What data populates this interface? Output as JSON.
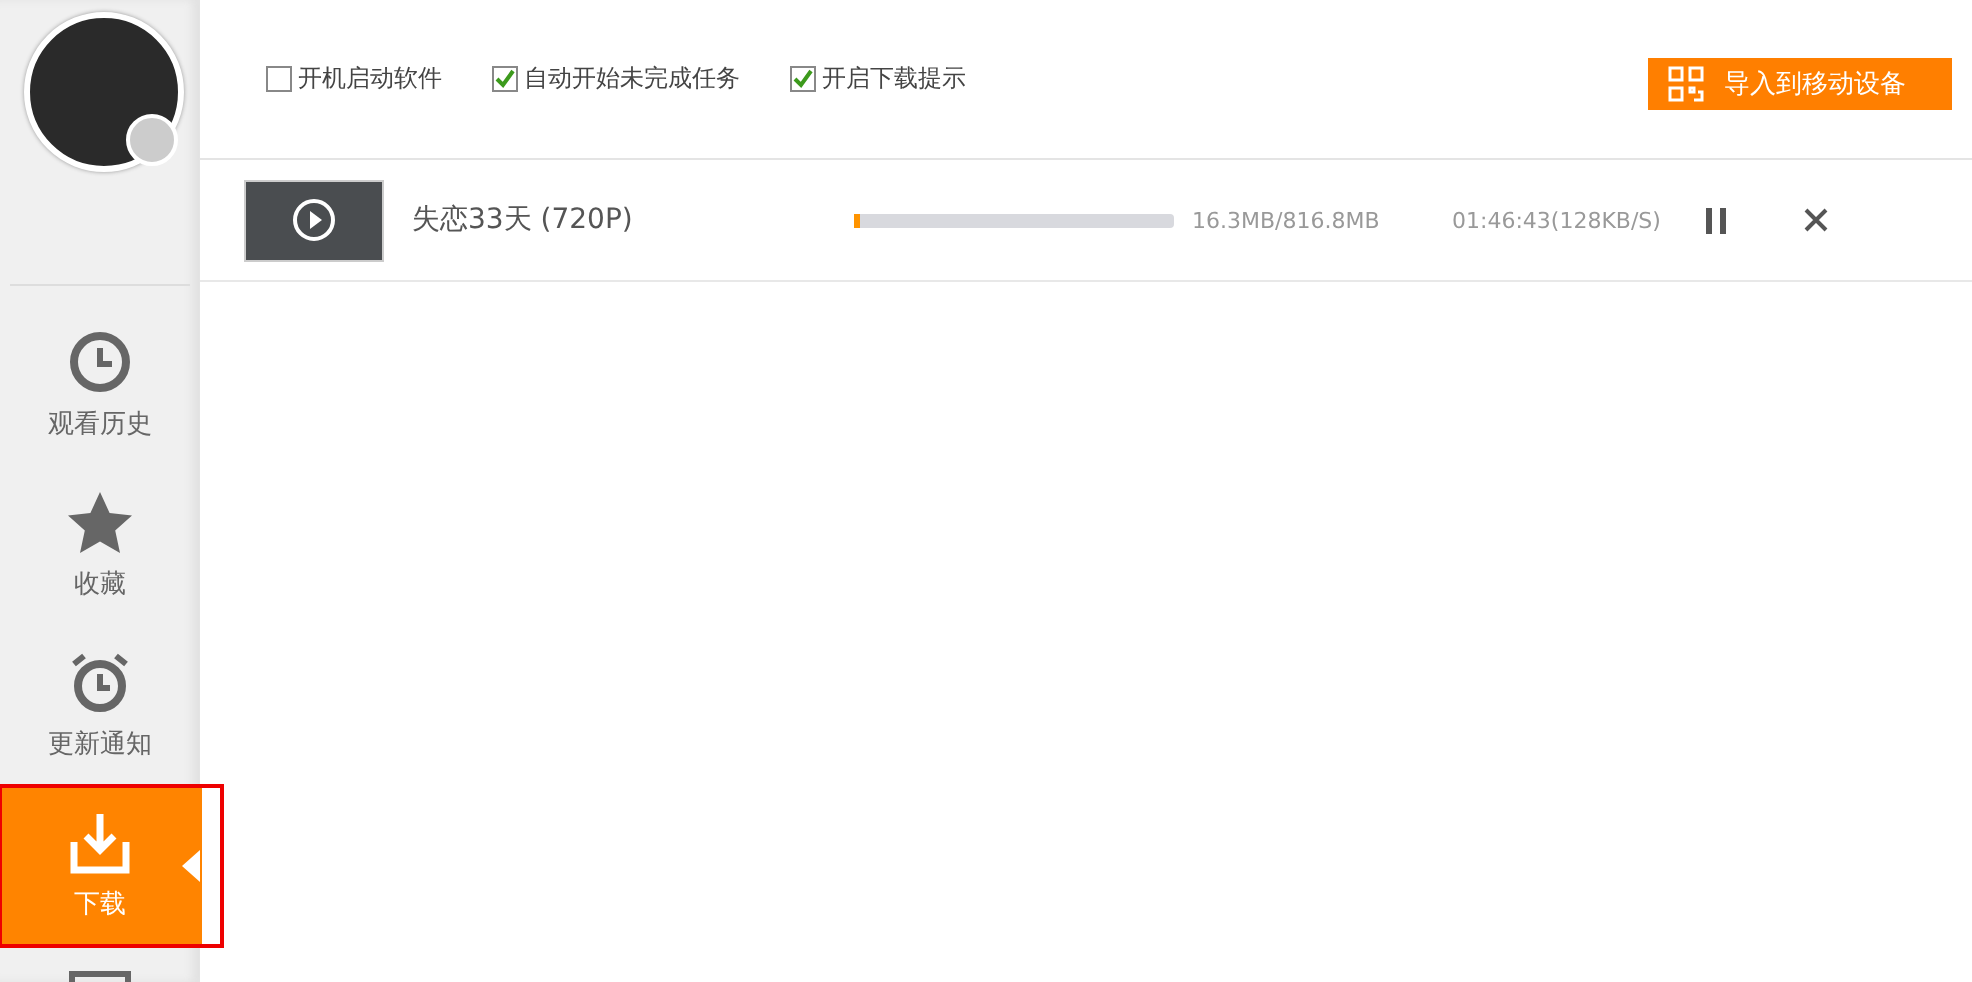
{
  "sidebar": {
    "items": [
      {
        "kind": "history",
        "label": "观看历史",
        "selected": false,
        "outlined": false
      },
      {
        "kind": "favorites",
        "label": "收藏",
        "selected": false,
        "outlined": false
      },
      {
        "kind": "updates",
        "label": "更新通知",
        "selected": false,
        "outlined": false
      },
      {
        "kind": "downloads",
        "label": "下载",
        "selected": true,
        "outlined": true
      },
      {
        "kind": "screen",
        "selected": false,
        "outlined": false
      }
    ]
  },
  "options": [
    {
      "label": "开机启动软件",
      "checked": false
    },
    {
      "label": "自动开始未完成任务",
      "checked": true
    },
    {
      "label": "开启下载提示",
      "checked": true
    }
  ],
  "import_button": "导入到移动设备",
  "downloads": [
    {
      "title": "失恋33天 (720P)",
      "level": 0.02,
      "size": "16.3MB/816.8MB",
      "remaining": "01:46:43(128KB/S)"
    }
  ]
}
